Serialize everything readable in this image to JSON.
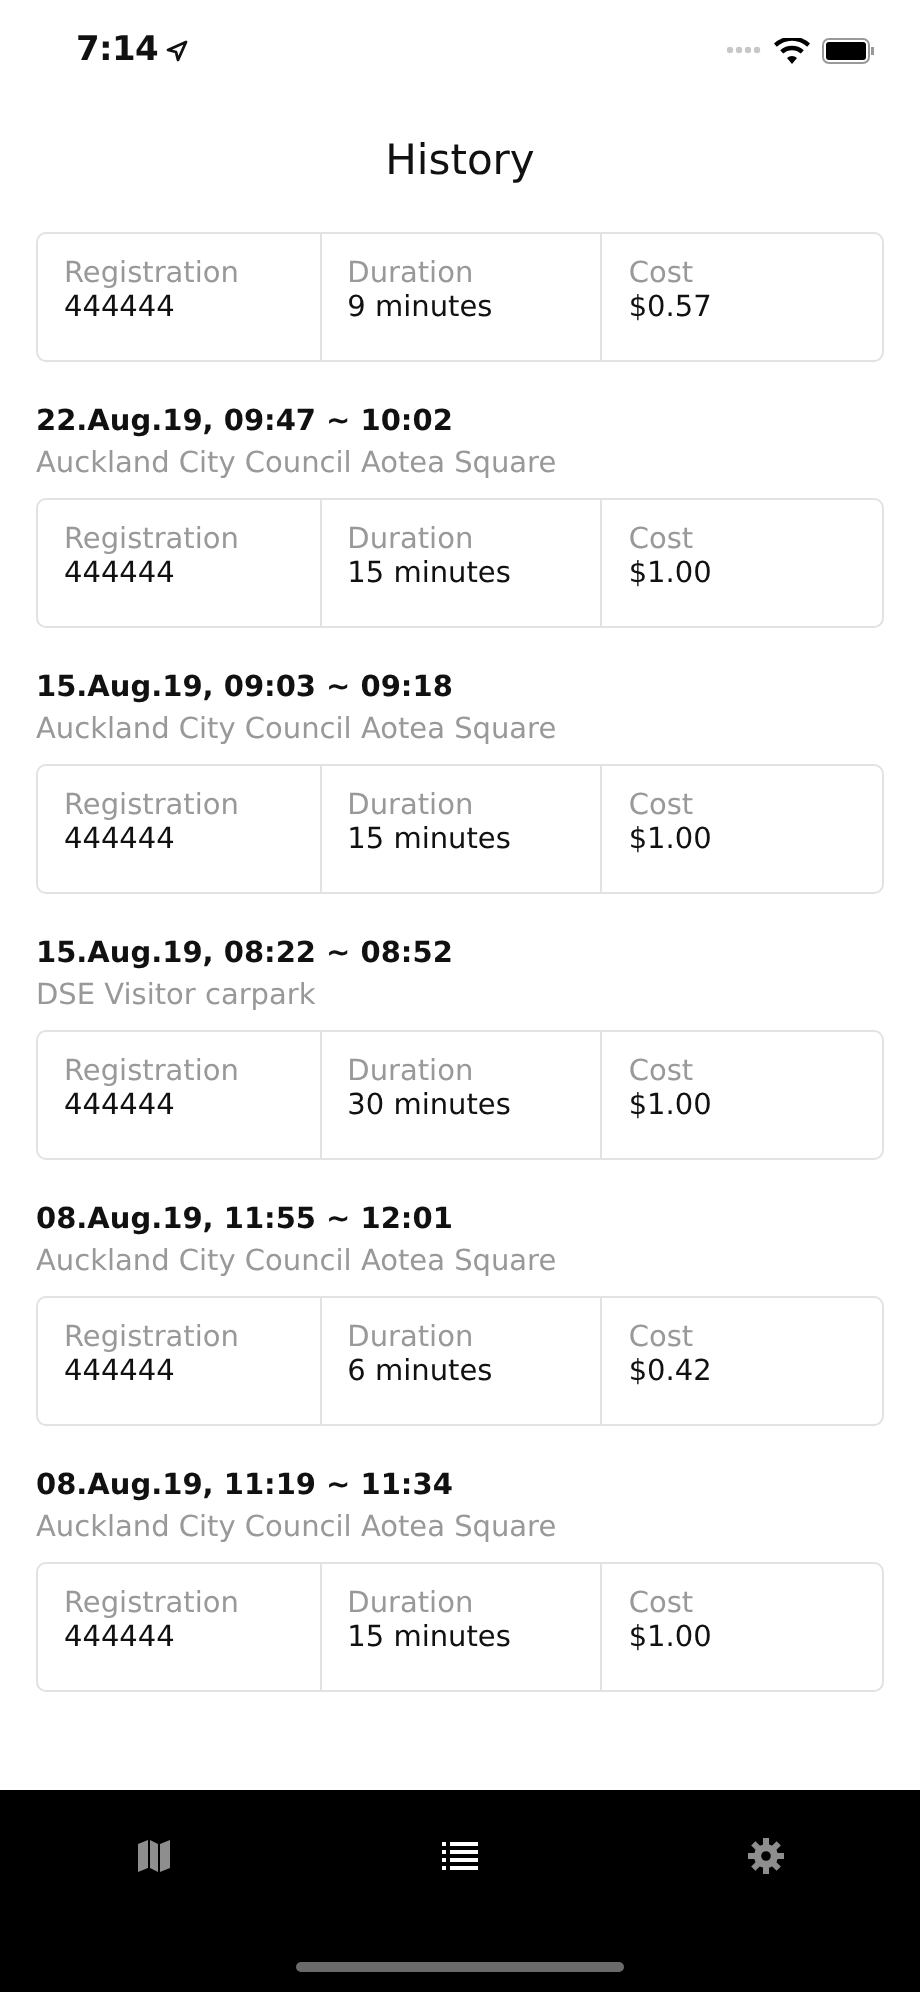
{
  "status_bar": {
    "time": "7:14"
  },
  "title": "History",
  "entries": [
    {
      "cells": [
        {
          "label": "Registration",
          "value": "444444"
        },
        {
          "label": "Duration",
          "value": "9 minutes"
        },
        {
          "label": "Cost",
          "value": "$0.57"
        }
      ]
    },
    {
      "when": "22.Aug.19, 09:47 ~ 10:02",
      "location": "Auckland City Council Aotea Square",
      "cells": [
        {
          "label": "Registration",
          "value": "444444"
        },
        {
          "label": "Duration",
          "value": "15 minutes"
        },
        {
          "label": "Cost",
          "value": "$1.00"
        }
      ]
    },
    {
      "when": "15.Aug.19, 09:03 ~ 09:18",
      "location": "Auckland City Council Aotea Square",
      "cells": [
        {
          "label": "Registration",
          "value": "444444"
        },
        {
          "label": "Duration",
          "value": "15 minutes"
        },
        {
          "label": "Cost",
          "value": "$1.00"
        }
      ]
    },
    {
      "when": "15.Aug.19, 08:22 ~ 08:52",
      "location": "DSE Visitor carpark",
      "cells": [
        {
          "label": "Registration",
          "value": "444444"
        },
        {
          "label": "Duration",
          "value": "30 minutes"
        },
        {
          "label": "Cost",
          "value": "$1.00"
        }
      ]
    },
    {
      "when": "08.Aug.19, 11:55 ~ 12:01",
      "location": "Auckland City Council Aotea Square",
      "cells": [
        {
          "label": "Registration",
          "value": "444444"
        },
        {
          "label": "Duration",
          "value": "6 minutes"
        },
        {
          "label": "Cost",
          "value": "$0.42"
        }
      ]
    },
    {
      "when": "08.Aug.19, 11:19 ~ 11:34",
      "location": "Auckland City Council Aotea Square",
      "cells": [
        {
          "label": "Registration",
          "value": "444444"
        },
        {
          "label": "Duration",
          "value": "15 minutes"
        },
        {
          "label": "Cost",
          "value": "$1.00"
        }
      ]
    }
  ],
  "tabs": [
    {
      "kind": "map",
      "selected": false
    },
    {
      "kind": "list",
      "selected": true
    },
    {
      "kind": "settings",
      "selected": false
    }
  ]
}
